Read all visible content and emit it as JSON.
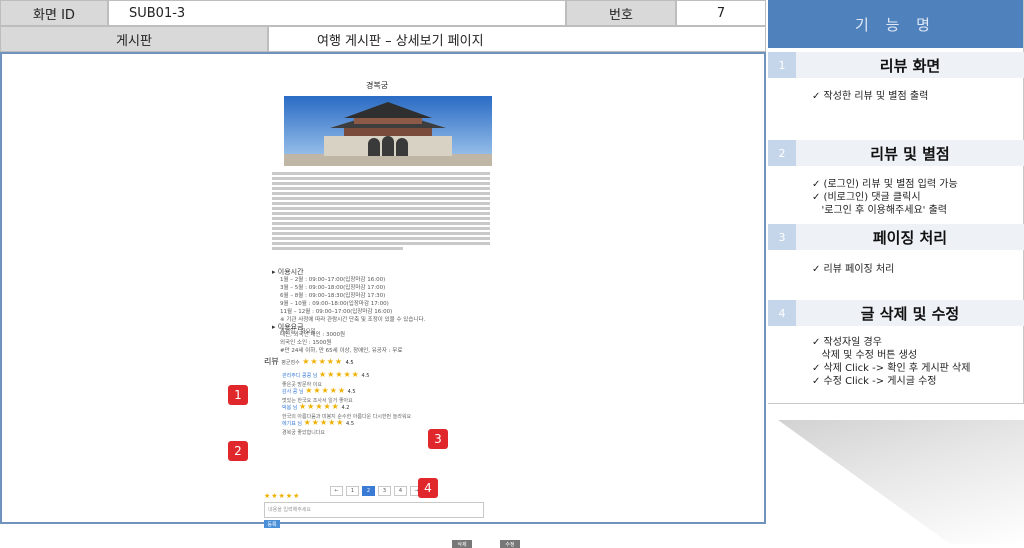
{
  "header": {
    "screen_id_label": "화면 ID",
    "screen_id": "SUB01-3",
    "number_label": "번호",
    "number": "7",
    "board_label": "게시판",
    "page_name": "여행 게시판 – 상세보기 페이지"
  },
  "preview": {
    "title": "경복궁",
    "info_sections": [
      {
        "label": "이용시간",
        "lines": [
          "1월 – 2월 : 09:00–17:00(입장마감 16:00)",
          "3월 – 5월 : 09:00–18:00(입장마감 17:00)",
          "6월 – 8월 : 09:00–18:30(입장마감 17:30)",
          "9월 – 10월 : 09:00–18:00(입장마감 17:00)",
          "11월 – 12월 : 09:00–17:00(입장마감 16:00)",
          "※ 기관 사정에 따라 관람시간 단축 및 조정이 있을 수 있습니다.",
          "휴관일 : 화요일"
        ]
      },
      {
        "label": "이용요금",
        "lines": [
          "대인, 외국인 대인 : 3000원",
          "외국인 소인 : 1500원",
          "#만 24세 이하, 만 65세 이상, 장애인, 유공자 : 무료"
        ]
      }
    ],
    "review_title": "리뷰",
    "avg_label": "평균점수",
    "avg_stars": "★★★★★",
    "avg_score": "4.5",
    "reviews": [
      {
        "user": "관리주디 콩콩 님",
        "stars": "★★★★★",
        "score": "4.5",
        "text": "좋은곳 방문하 이요"
      },
      {
        "user": "감사 콩 님",
        "stars": "★★★★★",
        "score": "4.5",
        "text": "멋있는 한국요 조사서 일거 좋아요"
      },
      {
        "user": "박봄 님",
        "stars": "★★★★★",
        "score": "4.2",
        "text": "한국의 아름다움과 미봉지 순수한 아름다운 다시한번 놀라워요"
      },
      {
        "user": "에기표 님",
        "stars": "★★★★★",
        "score": "4.5",
        "text": "경복궁 좋았합니다요"
      }
    ],
    "pagination": [
      "←",
      "1",
      "2",
      "3",
      "4",
      "→"
    ],
    "active_page": "2",
    "input_stars": "★★★★★",
    "input_placeholder": "내용을 입력해주세요",
    "submit_label": "등록",
    "delete_label": "삭제",
    "edit_label": "수정"
  },
  "badges": [
    "1",
    "2",
    "3",
    "4"
  ],
  "functions": {
    "title": "기 능 명",
    "items": [
      {
        "num": "1",
        "name": "리뷰 화면",
        "desc": [
          "✓ 작성한 리뷰 및 별점 출력"
        ]
      },
      {
        "num": "2",
        "name": "리뷰 및 별점",
        "desc": [
          "✓ (로그인) 리뷰 및 별점 입력 가능",
          "✓ (비로그인) 댓글 클릭시",
          "   '로그인 후 이용해주세요' 출력"
        ]
      },
      {
        "num": "3",
        "name": "페이징 처리",
        "desc": [
          "✓ 리뷰 페이징 처리"
        ]
      },
      {
        "num": "4",
        "name": "글 삭제 및 수정",
        "desc": [
          "✓ 작성자일 경우",
          "   삭제 및 수정 버튼 생성",
          "✓ 삭제 Click -> 확인 후 게시판 삭제",
          "✓ 수정 Click -> 게시글 수정"
        ]
      }
    ]
  },
  "colors": {
    "accent": "#4f81bd",
    "badge": "#e0272b",
    "star": "#f0b000",
    "button": "#4a90d9"
  }
}
